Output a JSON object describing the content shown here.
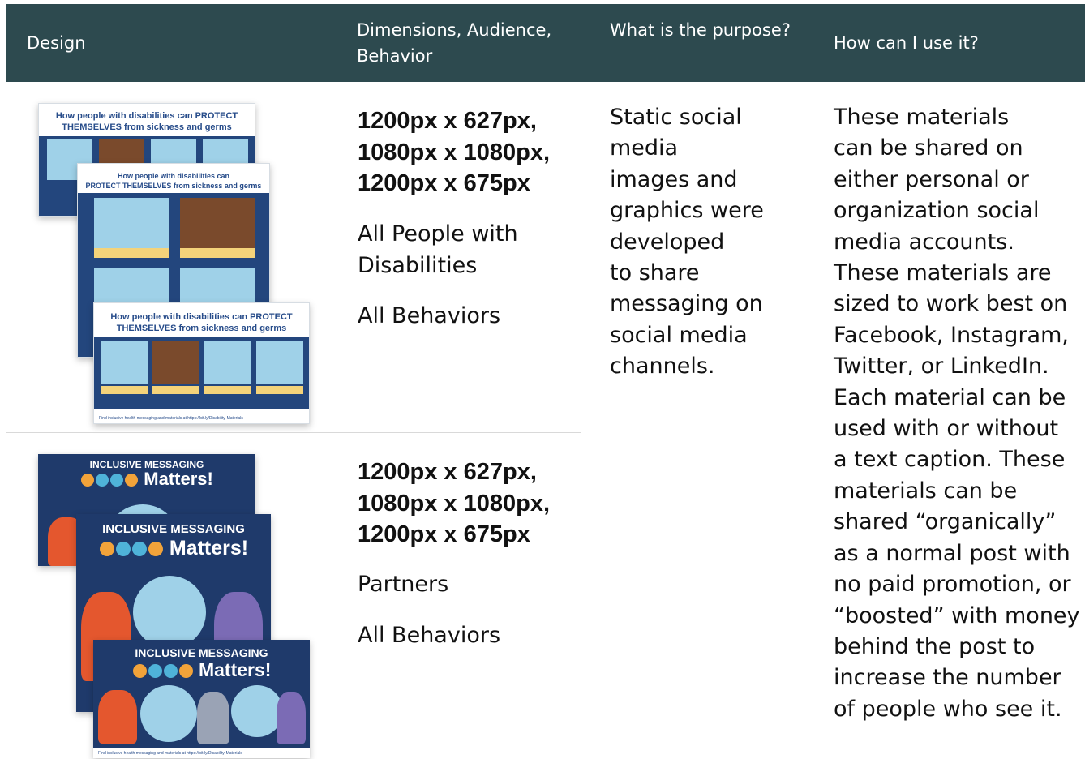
{
  "table": {
    "headers": [
      {
        "label": "Design"
      },
      {
        "label": "Dimensions, Audience, Behavior"
      },
      {
        "label": "What is the purpose?"
      },
      {
        "label": "How can I use it?"
      }
    ],
    "rows": [
      {
        "dimensions": [
          "1200px x 627px,",
          "1080px x 1080px,",
          "1200px x 675px"
        ],
        "audience": [
          "All People with",
          "Disabilities"
        ],
        "behavior": "All Behaviors",
        "design_title_part1": "How people with disabilities can PROTECT",
        "design_title_part2": "THEMSELVES from sickness and germs",
        "design_title_mid1": "How people with disabilities can",
        "design_title_mid2": "PROTECT THEMSELVES from sickness and germs",
        "design_footer": "Find inclusive health messaging and materials at https://bit.ly/Disability-Materials"
      },
      {
        "dimensions": [
          "1200px x 627px,",
          "1080px x 1080px,",
          "1200px x 675px"
        ],
        "audience": [
          "Partners"
        ],
        "behavior": "All Behaviors",
        "design_title_top": "INCLUSIVE MESSAGING",
        "design_title_big": "Matters!",
        "design_footer": "Find inclusive health messaging and materials at https://bit.ly/Disability-Materials"
      }
    ],
    "purpose_lines": [
      "Static social",
      "media",
      "images and",
      "graphics were",
      "developed",
      "to share",
      "messaging on",
      "social media",
      "channels."
    ],
    "howto_lines": [
      "These materials",
      "can be shared on",
      "either personal or",
      "organization social",
      "media accounts.",
      "These materials are",
      "sized to work best on",
      "Facebook, Instagram,",
      "Twitter, or LinkedIn.",
      "Each material can be",
      "used with or without",
      "a text caption. These",
      "materials can be",
      "shared “organically”",
      "as a normal post with",
      "no paid promotion, or",
      "“boosted” with money",
      "behind the post to",
      "increase the number",
      "of people who see it."
    ]
  },
  "colors": {
    "header_bg": "#2d4a4f",
    "header_text": "#ffffff",
    "brand_blue": "#274c8a",
    "dark_card": "#1f3a6b"
  }
}
